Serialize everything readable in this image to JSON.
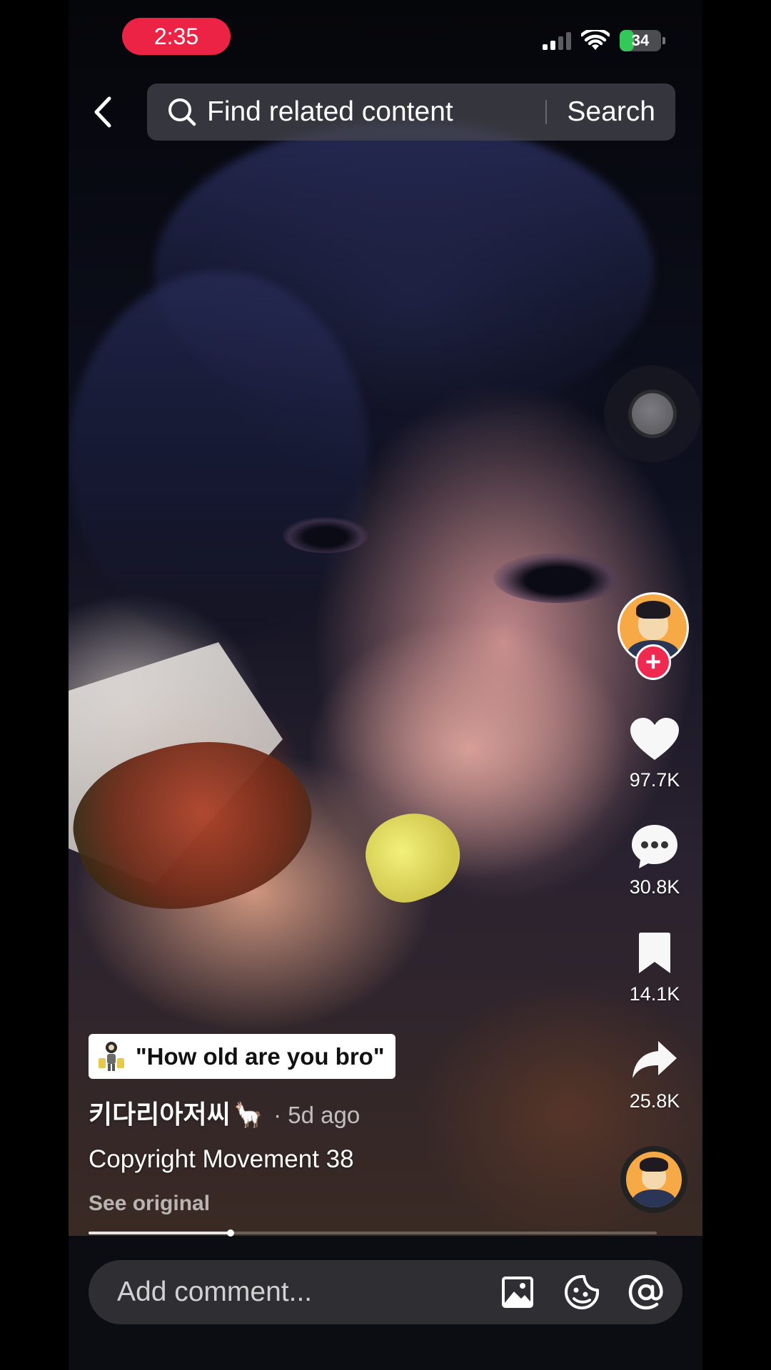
{
  "status_bar": {
    "time": "2:35",
    "battery_level": "34",
    "battery_fraction": 0.34,
    "signal_bars_active": 2,
    "signal_bars_total": 4,
    "time_pill_color": "#ec2344"
  },
  "top_bar": {
    "search_placeholder": "Find related content",
    "search_button_label": "Search"
  },
  "video": {
    "effect_chip_text": "\"How old are you bro\"",
    "author_name": "키다리아저씨",
    "author_emoji": "🦙",
    "posted": "· 5d ago",
    "caption": "Copyright Movement 38",
    "see_original_label": "See original",
    "progress_fraction": 0.25
  },
  "actions": {
    "follow_symbol": "+",
    "likes": "97.7K",
    "comments": "30.8K",
    "bookmarks": "14.1K",
    "shares": "25.8K",
    "accent_color": "#ef2950"
  },
  "comment_bar": {
    "placeholder": "Add comment...",
    "icons": [
      "image-icon",
      "sticker-icon",
      "mention-icon"
    ]
  }
}
